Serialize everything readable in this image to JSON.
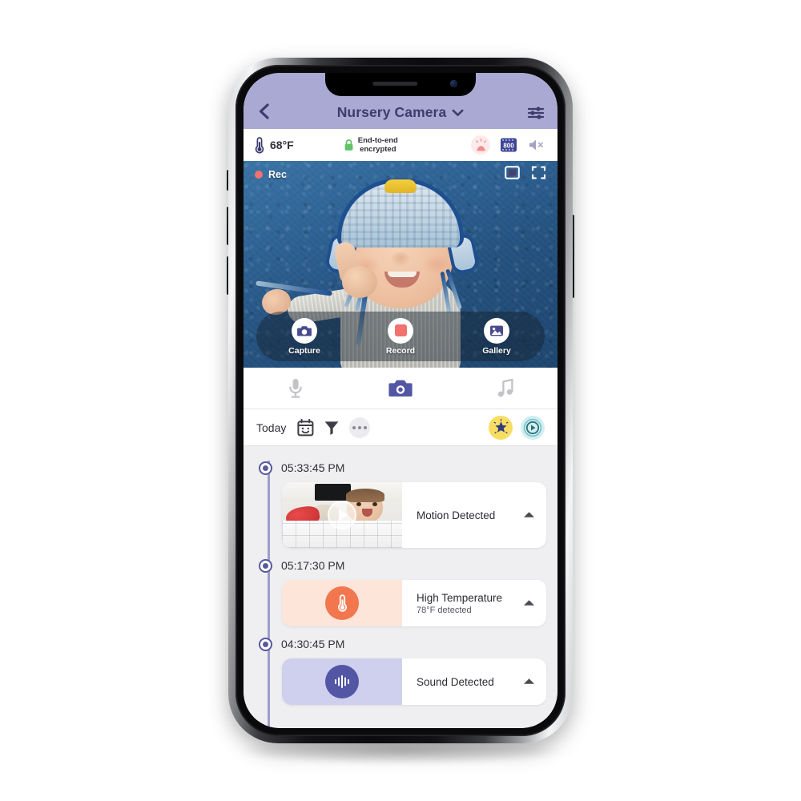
{
  "colors": {
    "header_bg": "#a9a9d3",
    "header_text": "#3c3c6e",
    "accent_purple": "#5356a4",
    "timeline_line": "#9d9ecb",
    "record_red": "#f1726e",
    "temp_orange": "#f2764e",
    "star_yellow": "#f7de63",
    "play_teal": "#d3eef0",
    "lock_green": "#63c268",
    "timeline_bg": "#efeff1"
  },
  "header": {
    "back_icon": "chevron-left-icon",
    "title": "Nursery Camera",
    "dropdown_icon": "chevron-down-icon",
    "settings_icon": "sliders-icon"
  },
  "status": {
    "temp_icon": "thermometer-icon",
    "temperature": "68°F",
    "lock_icon": "padlock-icon",
    "encryption_line1": "End-to-end",
    "encryption_line2": "encrypted",
    "alarm_icon": "alarm-siren-icon",
    "night_icon": "night-vision-800-icon",
    "night_label": "800",
    "speaker_icon": "speaker-muted-icon"
  },
  "video": {
    "rec_dot_icon": "record-dot-icon",
    "rec_label": "Rec",
    "pip_icon": "picture-in-picture-icon",
    "fullscreen_icon": "fullscreen-icon",
    "controls": [
      {
        "icon": "camera-icon",
        "label": "Capture"
      },
      {
        "icon": "record-icon",
        "label": "Record"
      },
      {
        "icon": "gallery-icon",
        "label": "Gallery"
      }
    ]
  },
  "mode_tabs": [
    {
      "icon": "microphone-icon",
      "name": "talk",
      "active": false
    },
    {
      "icon": "camera-icon",
      "name": "video",
      "active": true
    },
    {
      "icon": "music-note-icon",
      "name": "music",
      "active": false
    }
  ],
  "filter_bar": {
    "today_label": "Today",
    "calendar_icon": "calendar-smiley-icon",
    "filter_icon": "funnel-icon",
    "more_icon": "more-dots-icon",
    "star_icon": "sparkle-star-icon",
    "timelapse_icon": "play-circle-icon"
  },
  "timeline": {
    "events": [
      {
        "time": "05:33:45 PM",
        "title": "Motion Detected",
        "subtitle": "",
        "thumb_type": "motion-video-thumbnail",
        "icon": "play-button-overlay-icon",
        "caret_icon": "caret-up-icon"
      },
      {
        "time": "05:17:30 PM",
        "title": "High Temperature",
        "subtitle": "78°F  detected",
        "thumb_type": "temperature-tile",
        "icon": "thermometer-icon",
        "caret_icon": "caret-up-icon"
      },
      {
        "time": "04:30:45 PM",
        "title": "Sound Detected",
        "subtitle": "",
        "thumb_type": "sound-tile",
        "icon": "sound-wave-icon",
        "caret_icon": "caret-up-icon"
      }
    ]
  }
}
